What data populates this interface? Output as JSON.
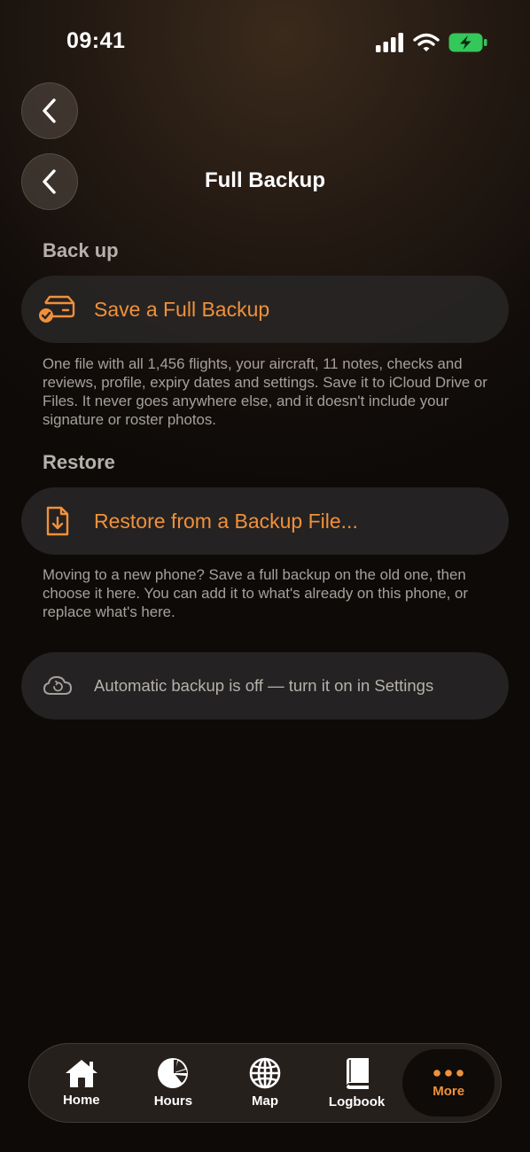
{
  "status_bar": {
    "time": "09:41",
    "battery_color": "#34c759"
  },
  "nav": {
    "title": "Full Backup"
  },
  "sections": {
    "backup": {
      "header": "Back up",
      "action_label": "Save a Full Backup",
      "action_icon": "drive-check-icon",
      "description": "One file with all 1,456 flights, your aircraft, 11 notes, checks and reviews, profile, expiry dates and settings. Save it to iCloud Drive or Files. It never goes anywhere else, and it doesn't include your signature or roster photos."
    },
    "restore": {
      "header": "Restore",
      "action_label": "Restore from a Backup File...",
      "action_icon": "file-download-icon",
      "description": "Moving to a new phone? Save a full backup on the old one, then choose it here. You can add it to what's already on this phone, or replace what's here."
    },
    "auto_backup": {
      "label": "Automatic backup is off — turn it on in Settings",
      "icon": "cloud-sync-icon"
    }
  },
  "tab_bar": {
    "tabs": [
      {
        "label": "Home",
        "icon": "home-icon"
      },
      {
        "label": "Hours",
        "icon": "pie-chart-icon"
      },
      {
        "label": "Map",
        "icon": "globe-icon"
      },
      {
        "label": "Logbook",
        "icon": "book-icon"
      },
      {
        "label": "More",
        "icon": "more-icon"
      }
    ],
    "active": "More"
  },
  "colors": {
    "accent": "#f0913a",
    "row_background": "#282626",
    "muted_text": "#a5a09b"
  }
}
